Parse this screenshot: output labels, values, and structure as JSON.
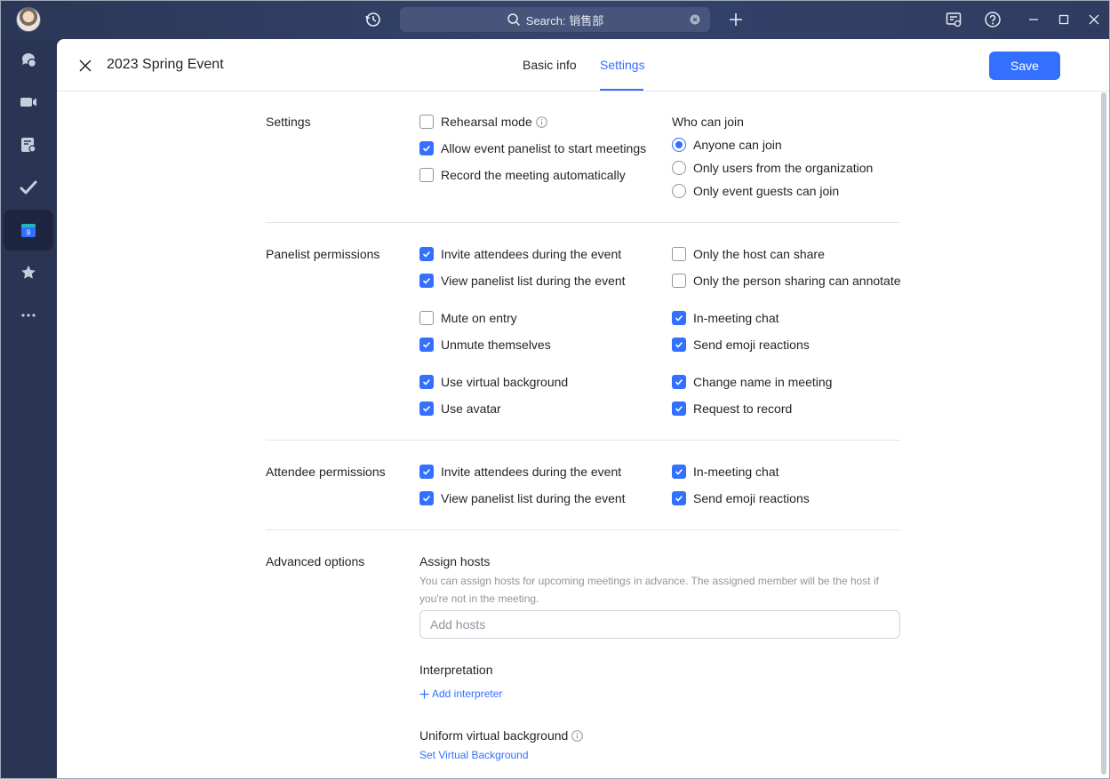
{
  "titlebar": {
    "search_text": "Search: 销售部"
  },
  "header": {
    "title": "2023 Spring Event",
    "tabs": [
      {
        "label": "Basic info",
        "active": false
      },
      {
        "label": "Settings",
        "active": true
      }
    ],
    "save_label": "Save"
  },
  "settings": {
    "label": "Settings",
    "options": [
      {
        "label": "Rehearsal mode",
        "checked": false
      },
      {
        "label": "Allow event panelist to start meetings",
        "checked": true
      },
      {
        "label": "Record the meeting automatically",
        "checked": false
      }
    ],
    "who_can_join": {
      "label": "Who can join",
      "options": [
        {
          "label": "Anyone can join",
          "selected": true
        },
        {
          "label": "Only users from the organization",
          "selected": false
        },
        {
          "label": "Only event guests can join",
          "selected": false
        }
      ]
    }
  },
  "panelist_permissions": {
    "label": "Panelist permissions",
    "left": [
      {
        "label": "Invite attendees during the event",
        "checked": true
      },
      {
        "label": "View panelist list during the event",
        "checked": true
      },
      {
        "label": "Mute on entry",
        "checked": false
      },
      {
        "label": "Unmute themselves",
        "checked": true
      },
      {
        "label": "Use virtual background",
        "checked": true
      },
      {
        "label": "Use avatar",
        "checked": true
      }
    ],
    "right": [
      {
        "label": "Only the host can share",
        "checked": false
      },
      {
        "label": "Only the person sharing can annotate",
        "checked": false
      },
      {
        "label": "In-meeting chat",
        "checked": true
      },
      {
        "label": "Send emoji reactions",
        "checked": true
      },
      {
        "label": "Change name in meeting",
        "checked": true
      },
      {
        "label": "Request to record",
        "checked": true
      }
    ]
  },
  "attendee_permissions": {
    "label": "Attendee permissions",
    "left": [
      {
        "label": "Invite attendees during the event",
        "checked": true
      },
      {
        "label": "View panelist list during the event",
        "checked": true
      }
    ],
    "right": [
      {
        "label": "In-meeting chat",
        "checked": true
      },
      {
        "label": "Send emoji reactions",
        "checked": true
      }
    ]
  },
  "advanced": {
    "label": "Advanced options",
    "assign_hosts": {
      "title": "Assign hosts",
      "hint": "You can assign hosts for upcoming meetings in advance. The assigned member will be the host if you're not in the meeting.",
      "placeholder": "Add hosts"
    },
    "interpretation": {
      "title": "Interpretation",
      "link": "Add interpreter"
    },
    "uniform_bg": {
      "title": "Uniform virtual background",
      "link": "Set Virtual Background"
    }
  },
  "colors": {
    "accent": "#3370ff",
    "rail": "#2a3554",
    "text": "#1f2329",
    "muted": "#8f959e"
  }
}
